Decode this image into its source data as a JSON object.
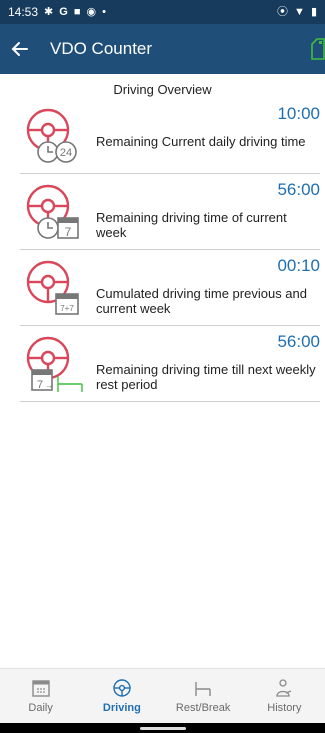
{
  "status_bar": {
    "time": "14:53",
    "icons_left": [
      "settings-icon",
      "google-icon",
      "square-icon",
      "record-icon",
      "dot-icon"
    ],
    "icons_right": [
      "location-icon",
      "wifi-icon",
      "battery-icon"
    ]
  },
  "app_bar": {
    "title": "VDO Counter",
    "back_icon": "back-arrow-icon",
    "device_icon_color": "#3fbf3f"
  },
  "section": {
    "title": "Driving Overview"
  },
  "cards": [
    {
      "value": "10:00",
      "label": "Remaining Current daily driving time",
      "badge": "24",
      "icon": "daily-driving-icon"
    },
    {
      "value": "56:00",
      "label": "Remaining driving time of current week",
      "badge": "7",
      "icon": "weekly-driving-icon"
    },
    {
      "value": "00:10",
      "label": "Cumulated driving time previous and current week",
      "badge": "7+7",
      "icon": "two-week-driving-icon"
    },
    {
      "value": "56:00",
      "label": "Remaining driving time till next weekly rest period",
      "badge": "7",
      "icon": "rest-period-driving-icon"
    }
  ],
  "bottom_nav": {
    "items": [
      {
        "label": "Daily",
        "icon": "calendar-icon"
      },
      {
        "label": "Driving",
        "icon": "steering-wheel-icon"
      },
      {
        "label": "Rest/Break",
        "icon": "bed-icon"
      },
      {
        "label": "History",
        "icon": "person-icon"
      }
    ],
    "active": "Driving"
  },
  "colors": {
    "status_bar": "#173b5c",
    "app_bar": "#1f4e79",
    "accent_value": "#1f6fb0",
    "wheel_red": "#d9475a",
    "nav_active": "#1f6fb0"
  }
}
